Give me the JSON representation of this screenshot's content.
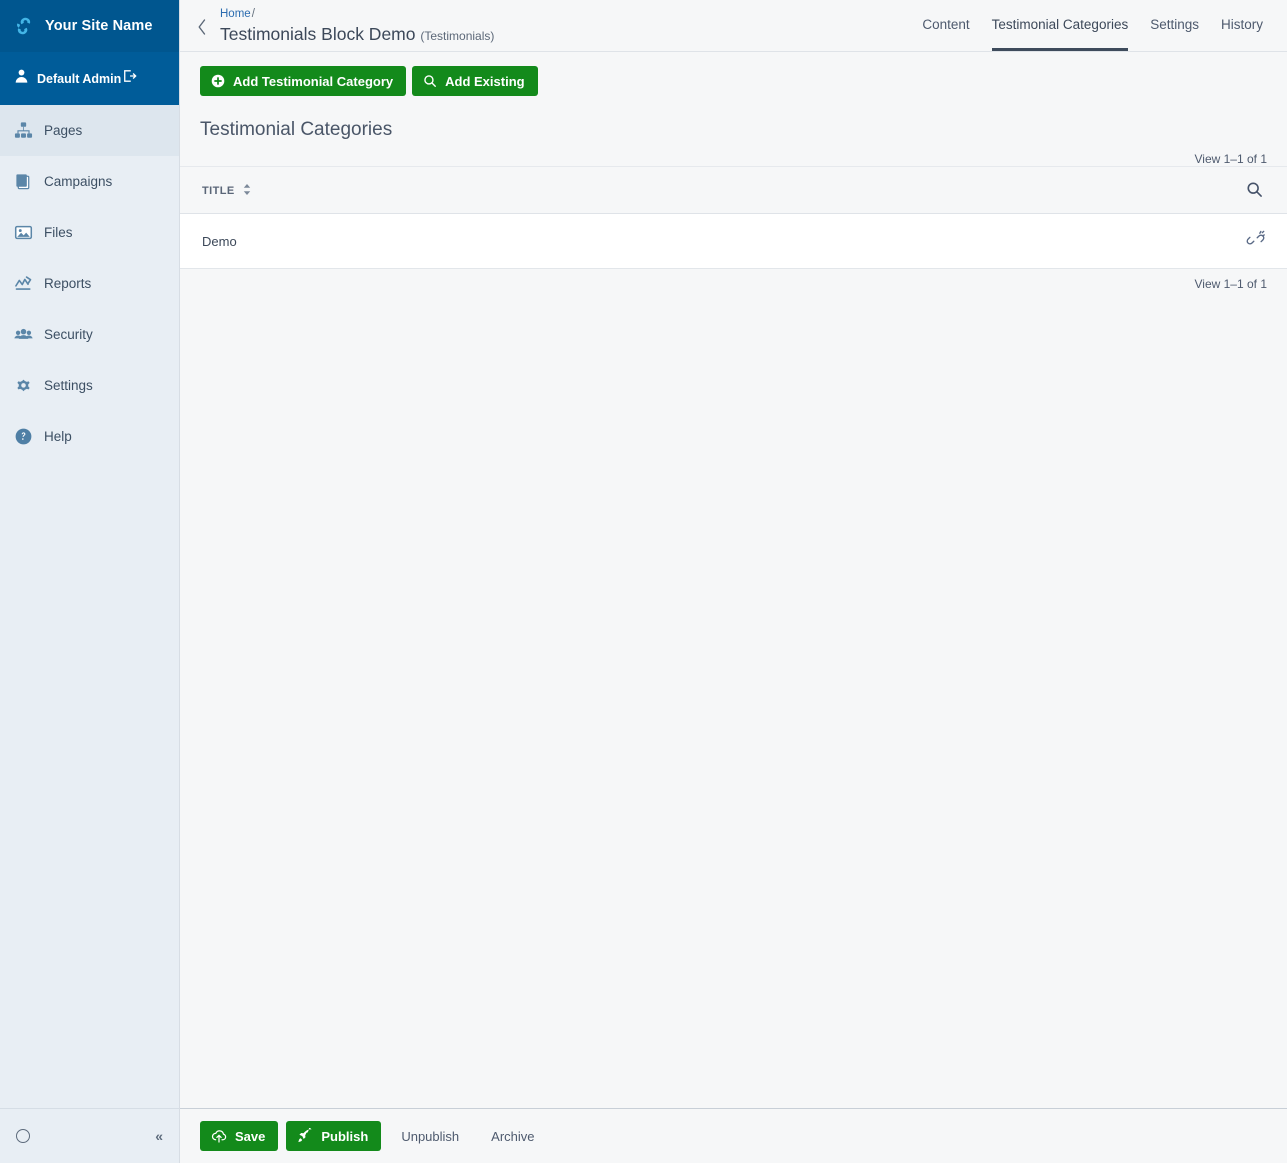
{
  "sidebar": {
    "brand": {
      "name": "Your Site Name",
      "logo_icon": "silverstripe-logo-icon"
    },
    "profile": {
      "name": "Default Admin",
      "user_icon": "user-icon",
      "logout_icon": "logout-icon"
    },
    "items": [
      {
        "label": "Pages",
        "icon": "sitemap-icon",
        "active": true
      },
      {
        "label": "Campaigns",
        "icon": "stacked-pages-icon",
        "active": false
      },
      {
        "label": "Files",
        "icon": "image-icon",
        "active": false
      },
      {
        "label": "Reports",
        "icon": "chart-line-icon",
        "active": false
      },
      {
        "label": "Security",
        "icon": "users-icon",
        "active": false
      },
      {
        "label": "Settings",
        "icon": "gear-icon",
        "active": false
      },
      {
        "label": "Help",
        "icon": "question-circle-icon",
        "active": false
      }
    ],
    "footer": {
      "spinner_icon": "loading-circle-icon",
      "collapse_label": "«"
    }
  },
  "header": {
    "back_icon": "chevron-left-icon",
    "breadcrumb_home": "Home",
    "breadcrumb_separator": "/",
    "title": "Testimonials Block Demo",
    "title_subtype": "(Testimonials)",
    "tabs": [
      {
        "label": "Content",
        "active": false
      },
      {
        "label": "Testimonial Categories",
        "active": true
      },
      {
        "label": "Settings",
        "active": false
      },
      {
        "label": "History",
        "active": false
      }
    ]
  },
  "toolbar": {
    "add_new_label": "Add Testimonial Category",
    "add_new_icon": "plus-circle-icon",
    "add_existing_label": "Add Existing",
    "add_existing_icon": "search-icon",
    "accent_green": "#138a1b"
  },
  "panel": {
    "heading": "Testimonial Categories",
    "view_count_top": "View 1–1 of 1",
    "view_count_bottom": "View 1–1 of 1",
    "search_icon": "search-icon",
    "sort_icon": "sort-updown-icon",
    "columns": [
      "TITLE"
    ],
    "rows": [
      {
        "title": "Demo",
        "action_icon": "unlink-icon"
      }
    ]
  },
  "footer": {
    "save_label": "Save",
    "save_icon": "cloud-upload-icon",
    "publish_label": "Publish",
    "publish_icon": "rocket-icon",
    "unpublish_label": "Unpublish",
    "archive_label": "Archive"
  }
}
